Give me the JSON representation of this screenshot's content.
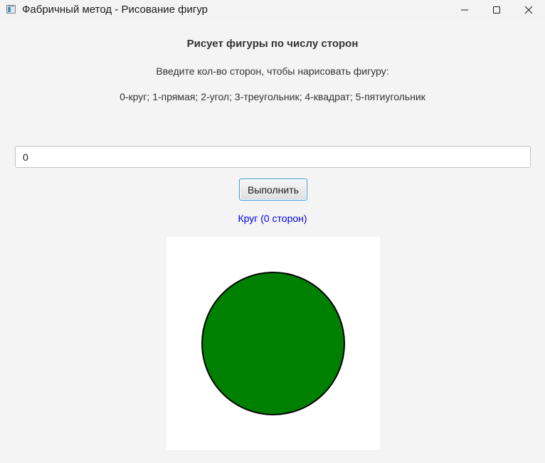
{
  "window": {
    "title": "Фабричный метод - Рисование фигур",
    "controls": [
      "minimize-icon",
      "maximize-icon",
      "close-icon"
    ]
  },
  "main": {
    "heading": "Рисует фигуры по числу сторон",
    "instruction": "Введите кол-во сторон, чтобы нарисовать фигуру:",
    "legend": "0-круг; 1-прямая; 2-угол; 3-треугольник; 4-квадрат; 5-пятиугольник",
    "input_value": "0",
    "button_label": "Выполнить",
    "result_text": "Круг (0 сторон)",
    "result_color": "#0000e6"
  },
  "canvas": {
    "shape": "circle",
    "fill_color": "#008000",
    "stroke_color": "#000000",
    "background": "#ffffff"
  }
}
